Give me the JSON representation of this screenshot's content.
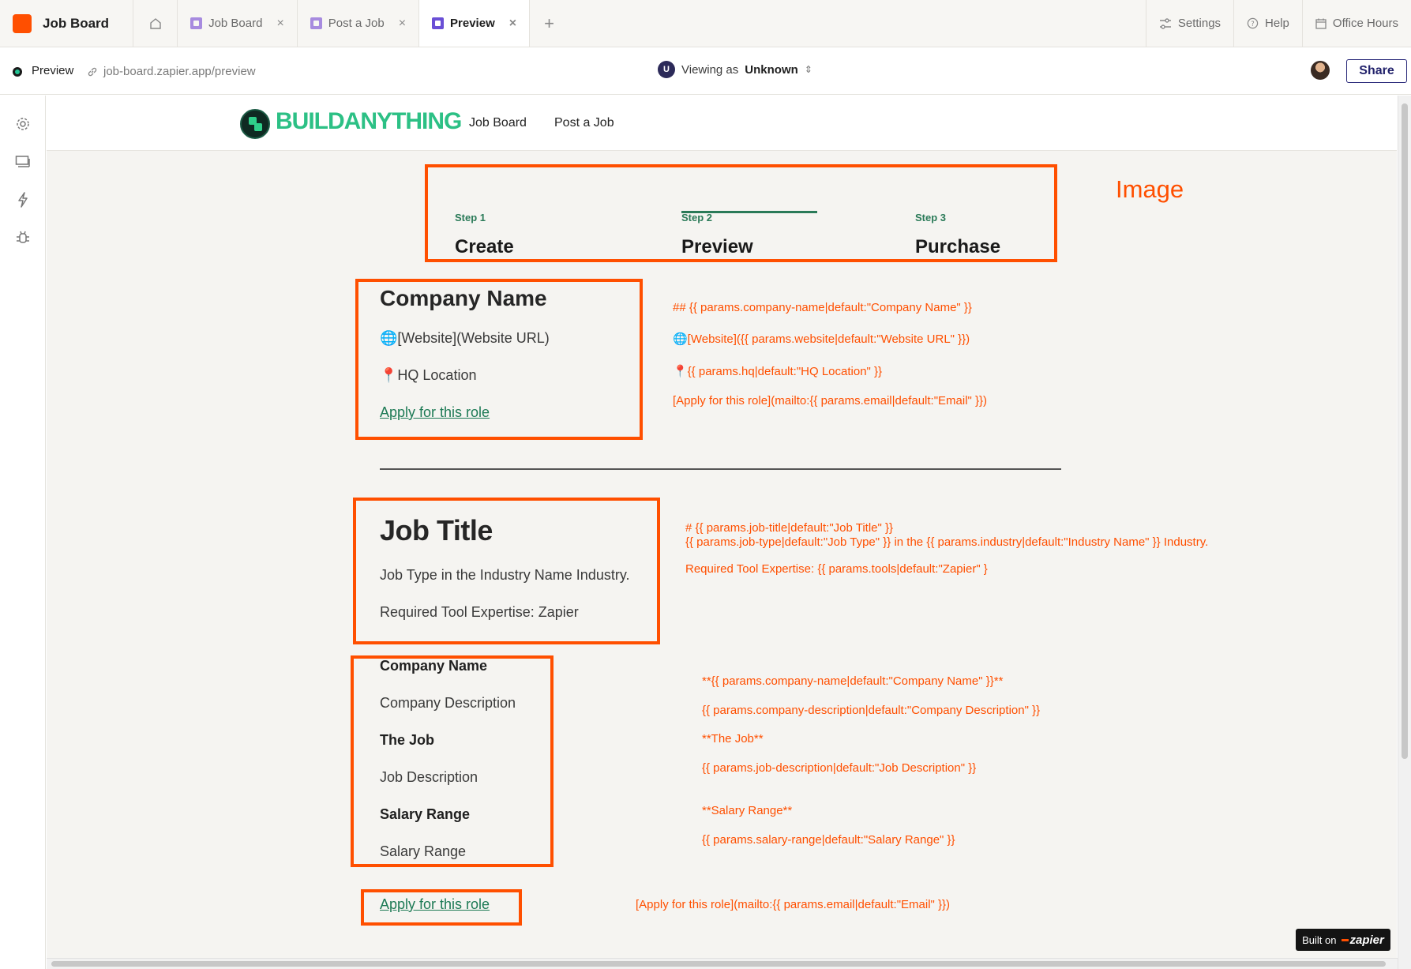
{
  "app": {
    "title": "Job Board",
    "brand_color": "#ff4f00"
  },
  "tabs": [
    {
      "label": "Job Board",
      "close": "×"
    },
    {
      "label": "Post a Job",
      "close": "×"
    },
    {
      "label": "Preview",
      "close": "×"
    }
  ],
  "tab_add": "+",
  "toolbar": {
    "settings": "Settings",
    "help": "Help",
    "office_hours": "Office Hours"
  },
  "subbar": {
    "page": "Preview",
    "url": "job-board.zapier.app/preview",
    "viewing_prefix": "Viewing as",
    "viewing_user": "Unknown",
    "viewing_initial": "U",
    "share": "Share"
  },
  "site": {
    "logo": "BUILDANYTHING",
    "nav": [
      "Job Board",
      "Post a Job"
    ]
  },
  "steps": [
    {
      "label": "Step 1",
      "name": "Create"
    },
    {
      "label": "Step 2",
      "name": "Preview"
    },
    {
      "label": "Step 3",
      "name": "Purchase"
    }
  ],
  "company": {
    "name": "Company Name",
    "website": "🌐[Website](Website URL)",
    "hq": "📍HQ Location",
    "apply": "Apply for this role"
  },
  "job": {
    "title": "Job Title",
    "type_line": "Job Type in the Industry Name Industry.",
    "tools_line": "Required Tool Expertise: Zapier"
  },
  "details": {
    "company_heading": "Company Name",
    "company_desc": "Company Description",
    "job_heading": "The Job",
    "job_desc": "Job Description",
    "salary_heading": "Salary Range",
    "salary_value": "Salary Range",
    "apply": "Apply for this role"
  },
  "annotations": {
    "image_label": "Image",
    "company_name": "## {{ params.company-name|default:\"Company Name\" }}",
    "website": "🌐[Website]({{ params.website|default:\"Website URL\" }})",
    "hq": "📍{{ params.hq|default:\"HQ Location\" }}",
    "apply1": "[Apply for this role](mailto:{{ params.email|default:\"Email\" }})",
    "job_title": "# {{ params.job-title|default:\"Job Title\" }}",
    "job_type": "{{ params.job-type|default:\"Job Type\" }} in the {{ params.industry|default:\"Industry Name\" }} Industry.",
    "tools": "Required Tool Expertise: {{ params.tools|default:\"Zapier\" }",
    "company_bold": "**{{ params.company-name|default:\"Company Name\" }}**",
    "company_desc": "{{ params.company-description|default:\"Company Description\" }}",
    "the_job": "**The Job**",
    "job_desc": "{{ params.job-description|default:\"Job Description\" }}",
    "salary_bold": "**Salary Range**",
    "salary": "{{ params.salary-range|default:\"Salary Range\" }}",
    "apply2": "[Apply for this role](mailto:{{ params.email|default:\"Email\" }})"
  },
  "badge": {
    "prefix": "Built on",
    "brand": "zapier"
  }
}
